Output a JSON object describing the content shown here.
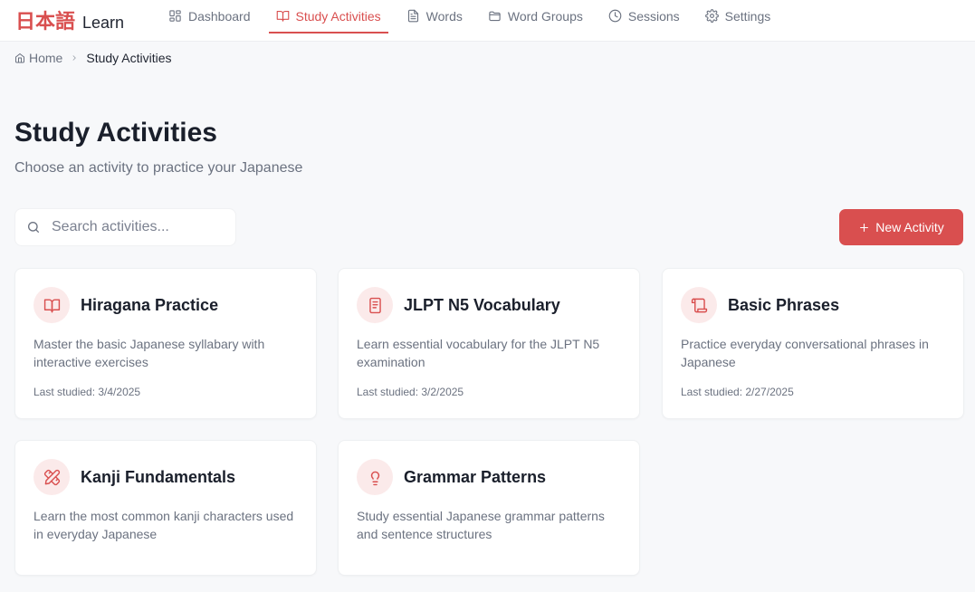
{
  "header": {
    "logo_jp": "日本語",
    "logo_en": "Learn",
    "nav": [
      {
        "label": "Dashboard",
        "icon": "dashboard-grid-icon"
      },
      {
        "label": "Study Activities",
        "icon": "book-open-icon",
        "active": true
      },
      {
        "label": "Words",
        "icon": "document-icon"
      },
      {
        "label": "Word Groups",
        "icon": "folder-icon"
      },
      {
        "label": "Sessions",
        "icon": "clock-icon"
      },
      {
        "label": "Settings",
        "icon": "gear-icon"
      }
    ]
  },
  "breadcrumb": {
    "home": "Home",
    "current": "Study Activities"
  },
  "page": {
    "title": "Study Activities",
    "subtitle": "Choose an activity to practice your Japanese"
  },
  "search": {
    "placeholder": "Search activities..."
  },
  "actions": {
    "new_activity": "New Activity"
  },
  "activities": [
    {
      "title": "Hiragana Practice",
      "description": "Master the basic Japanese syllabary with interactive exercises",
      "last_studied": "Last studied: 3/4/2025",
      "icon": "book-open-icon"
    },
    {
      "title": "JLPT N5 Vocabulary",
      "description": "Learn essential vocabulary for the JLPT N5 examination",
      "last_studied": "Last studied: 3/2/2025",
      "icon": "notebook-icon"
    },
    {
      "title": "Basic Phrases",
      "description": "Practice everyday conversational phrases in Japanese",
      "last_studied": "Last studied: 2/27/2025",
      "icon": "scroll-icon"
    },
    {
      "title": "Kanji Fundamentals",
      "description": "Learn the most common kanji characters used in everyday Japanese",
      "icon": "pencil-ruler-icon"
    },
    {
      "title": "Grammar Patterns",
      "description": "Study essential Japanese grammar patterns and sentence structures",
      "icon": "lightbulb-icon"
    }
  ],
  "colors": {
    "accent": "#d94f4f",
    "accent_soft": "#fbeaea",
    "background": "#f7f8fa"
  }
}
